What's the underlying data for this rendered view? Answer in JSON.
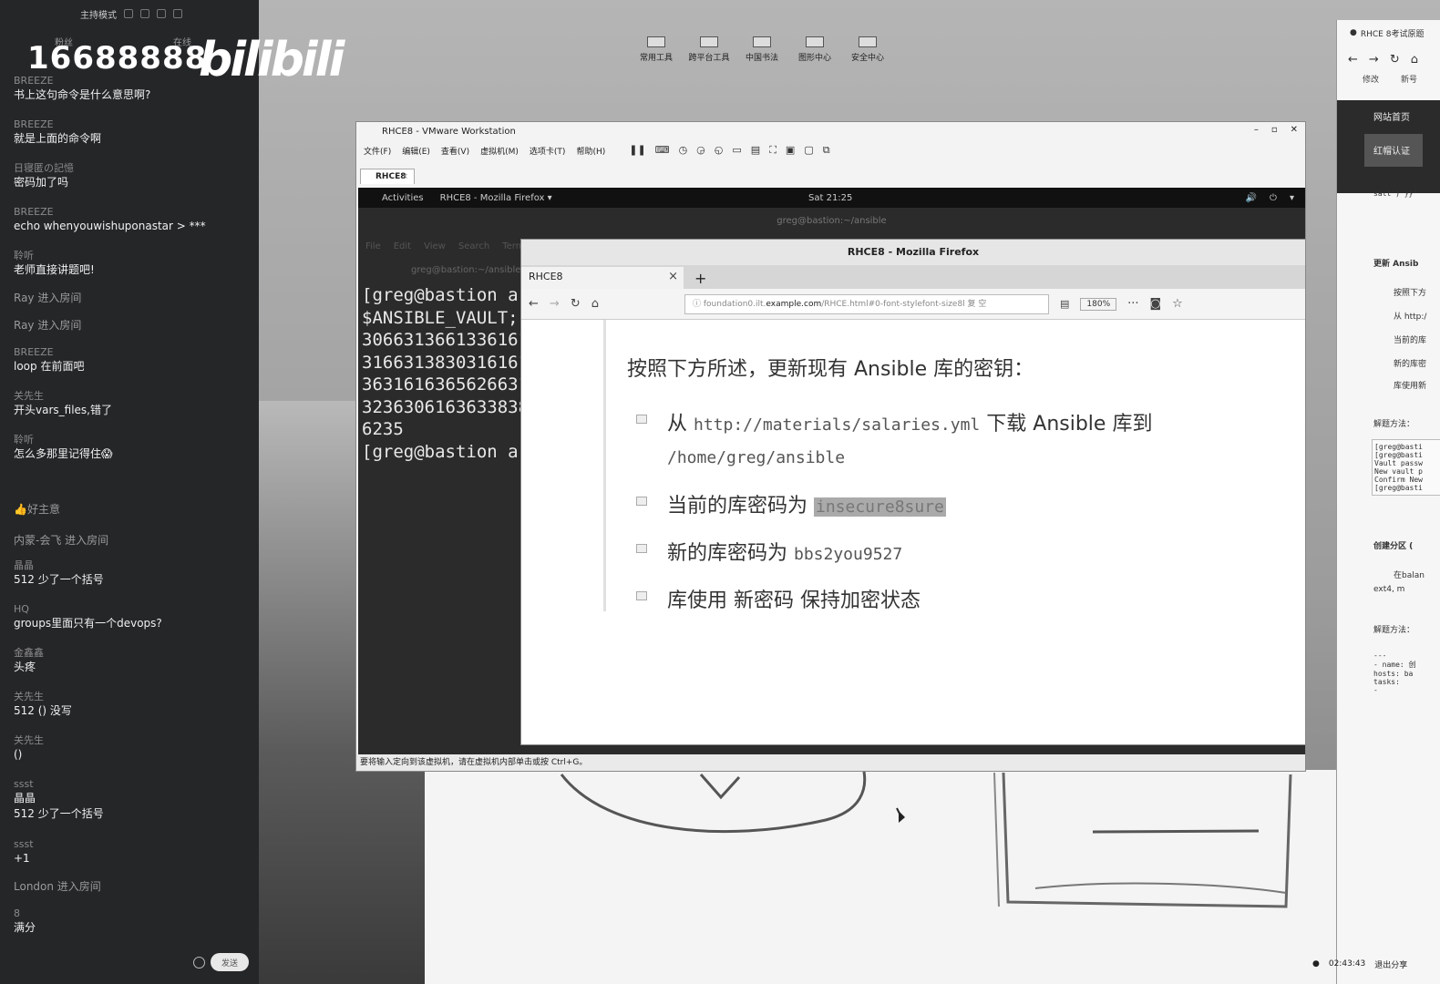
{
  "chat": {
    "host_mode": "主持模式",
    "watermark": "16688888",
    "logo": "bilibili",
    "tabs": [
      "粉丝",
      "在线"
    ],
    "messages": [
      {
        "name": "BREEZE",
        "text": "书上这句命令是什么意思啊?"
      },
      {
        "name": "BREEZE",
        "text": "就是上面的命令啊"
      },
      {
        "name": "日寝匿の記憶",
        "text": "密码加了吗"
      },
      {
        "name": "BREEZE",
        "text": "echo whenyouwishuponastar > ***"
      },
      {
        "name": "聆听",
        "text": "老师直接讲题吧!"
      },
      {
        "name": "Ray 进入房间",
        "text": ""
      },
      {
        "name": "Ray 进入房间",
        "text": ""
      },
      {
        "name": "BREEZE",
        "text": "loop 在前面吧"
      },
      {
        "name": "关先生",
        "text": "开头vars_files,错了"
      },
      {
        "name": "聆听",
        "text": "怎么多那里记得住😱"
      },
      {
        "name": "👍好主意",
        "text": ""
      },
      {
        "name": "内蒙-会飞 进入房间",
        "text": ""
      },
      {
        "name": "晶晶",
        "text": "512 少了一个括号"
      },
      {
        "name": "HQ",
        "text": "groups里面只有一个devops?"
      },
      {
        "name": "金鑫鑫",
        "text": "头疼"
      },
      {
        "name": "关先生",
        "text": "512 () 没写"
      },
      {
        "name": "关先生",
        "text": "()"
      },
      {
        "name": "ssst",
        "text": "晶晶\n512 少了一个括号"
      },
      {
        "name": "ssst",
        "text": "+1"
      },
      {
        "name": "London 进入房间",
        "text": ""
      },
      {
        "name": "8",
        "text": "满分"
      }
    ],
    "send_label": "发送"
  },
  "desktop_icons": [
    "常用工具",
    "跨平台工具",
    "中国书法",
    "图形中心",
    "安全中心"
  ],
  "vmware": {
    "title": "RHCE8 - VMware Workstation",
    "menu": [
      "文件(F)",
      "编辑(E)",
      "查看(V)",
      "虚拟机(M)",
      "选项卡(T)",
      "帮助(H)"
    ],
    "tab": "RHCE8",
    "status": "要将输入定向到该虚拟机，请在虚拟机内部单击或按 Ctrl+G。"
  },
  "gnome": {
    "activities": "Activities",
    "app": "RHCE8 - Mozilla Firefox ▾",
    "clock": "Sat 21:25"
  },
  "terminal": {
    "title": "greg@bastion:~/ansible",
    "menu": [
      "File",
      "Edit",
      "View",
      "Search",
      "Terminal"
    ],
    "subtitle": "greg@bastion:~/ansible",
    "lines": [
      "[greg@bastion a",
      "$ANSIBLE_VAULT;",
      "3066313661336161",
      "3166313830316161",
      "3631616365626631",
      "3236306163633838",
      "6235",
      "[greg@bastion a"
    ]
  },
  "firefox": {
    "title": "RHCE8 - Mozilla Firefox",
    "tab": "RHCE8",
    "url_prefix": "foundation0.ilt.",
    "url_host": "example.com",
    "url_rest": "/RHCE.html#0-font-stylefont-size8l 复 空",
    "zoom": "180%",
    "task_title": "按照下方所述，更新现有 Ansible 库的密钥：",
    "items": [
      {
        "pre": "从 ",
        "code": "http://materials/salaries.yml",
        "post": " 下载 Ansible 库到"
      },
      {
        "pre": "",
        "code": "/home/greg/ansible",
        "post": ""
      },
      {
        "pre": "当前的库密码为 ",
        "code": "insecure8sure",
        "post": ""
      },
      {
        "pre": "新的库密码为 ",
        "code": "bbs2you9527",
        "post": ""
      },
      {
        "pre": "库使用 新密码 保持加密状态",
        "code": "",
        "post": ""
      }
    ]
  },
  "right_browser": {
    "tab": "RHCE 8考试原题",
    "bookmarks": [
      "修改",
      "新号"
    ],
    "side_items": [
      "网站首页",
      "红帽认证"
    ],
    "lines": [
      "salt') }}\"",
      "更新 Ansib",
      "按照下方",
      "从 http:/",
      "当前的库",
      "新的库密",
      "库使用新",
      "解题方法：",
      "创建分区 (",
      "在balan",
      "ext4, m",
      "解题方法："
    ],
    "code1": [
      "[greg@basti",
      "[greg@basti",
      "Vault passw",
      "New vault p",
      "Confirm New",
      "[greg@basti"
    ],
    "code2": [
      "---",
      "- name: 创",
      "  hosts: ba",
      "  tasks:",
      "    -"
    ]
  },
  "systray": {
    "time": "02:43:43",
    "exit": "退出分享"
  }
}
